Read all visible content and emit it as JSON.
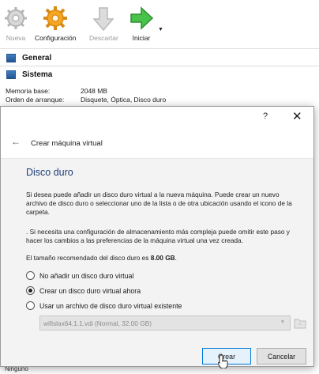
{
  "toolbar": {
    "new_label": "Nueva",
    "settings_label": "Configuración",
    "discard_label": "Descartar",
    "start_label": "Iniciar",
    "icons": {
      "new": "gear-sparkle-icon",
      "settings": "gear-icon",
      "discard": "discard-arrow-icon",
      "start": "start-arrow-icon"
    }
  },
  "details": {
    "general_heading": "General",
    "system_heading": "Sistema",
    "rows": [
      {
        "key": "Memoria base:",
        "value": "2048 MB"
      },
      {
        "key": "Orden de arranque:",
        "value": "Disquete, Óptica, Disco duro"
      }
    ],
    "bottom_text": "Ninguno"
  },
  "dialog": {
    "help_label": "?",
    "close_label": "✕",
    "back_label": "←",
    "wizard_title": "Crear máquina virtual",
    "page_title": "Disco duro",
    "paragraph1": "Si desea puede añadir un disco duro virtual a la nueva máquina. Puede crear un nuevo archivo de disco duro o seleccionar uno de la lista o de otra ubicación usando el icono de la carpeta.",
    "paragraph2": ". Si necesita una configuración de almacenamiento más compleja puede omitir este paso y hacer los cambios a las preferencias de la máquina virtual una vez creada.",
    "recommended_prefix": "El tamaño recomendado del disco duro es ",
    "recommended_size": "8.00 GB",
    "recommended_suffix": ".",
    "options": [
      {
        "label": "No añadir un disco duro virtual",
        "selected": false
      },
      {
        "label": "Crear un disco duro virtual ahora",
        "selected": true
      },
      {
        "label": "Usar un archivo de disco duro virtual existente",
        "selected": false
      }
    ],
    "existing_disk_value": "wifislax64.1.1.vdi (Normal, 32.00 GB)",
    "create_button": "Crear",
    "cancel_button": "Cancelar"
  },
  "colors": {
    "accent": "#1f3d77",
    "primary_button_border": "#0078d7",
    "start_arrow": "#3cb43c",
    "settings_gear": "#f5a623"
  }
}
